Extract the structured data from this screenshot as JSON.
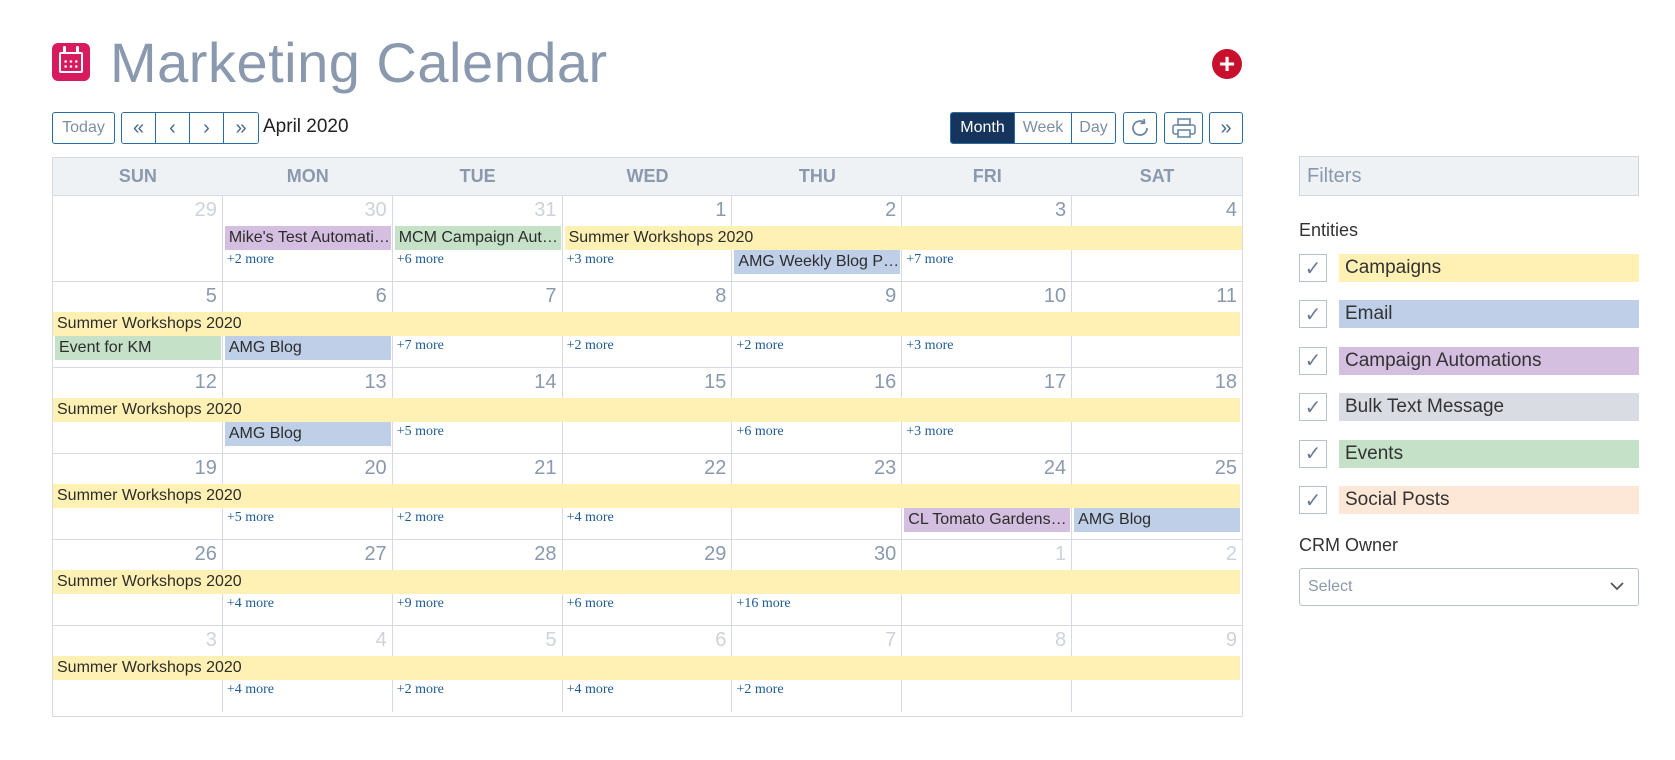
{
  "header": {
    "title": "Marketing Calendar",
    "add_label": "+"
  },
  "toolbar": {
    "today": "Today",
    "nav": [
      "«",
      "‹",
      "›",
      "»"
    ],
    "month_label": "April 2020",
    "views": [
      "Month",
      "Week",
      "Day"
    ],
    "active_view": "Month"
  },
  "calendar": {
    "days_of_week": [
      "SUN",
      "MON",
      "TUE",
      "WED",
      "THU",
      "FRI",
      "SAT"
    ],
    "weeks": [
      {
        "days": [
          [
            "29",
            true
          ],
          [
            "30",
            true
          ],
          [
            "31",
            true
          ],
          [
            "1",
            false
          ],
          [
            "2",
            false
          ],
          [
            "3",
            false
          ],
          [
            "4",
            false
          ]
        ],
        "events": [
          {
            "label": "Mike's Test Automation",
            "type": "auto",
            "start": 1,
            "span": 1,
            "row": 0
          },
          {
            "label": "MCM Campaign Automation",
            "type": "event",
            "start": 2,
            "span": 1,
            "row": 0
          },
          {
            "label": "Summer Workshops 2020",
            "type": "camp",
            "start": 3,
            "span": 4,
            "row": 0
          },
          {
            "label": "AMG Weekly Blog Post",
            "type": "email",
            "start": 4,
            "span": 1,
            "row": 1
          }
        ],
        "more": [
          {
            "label": "+2 more",
            "col": 1
          },
          {
            "label": "+6 more",
            "col": 2
          },
          {
            "label": "+3 more",
            "col": 3
          },
          {
            "label": "+7 more",
            "col": 5
          }
        ]
      },
      {
        "days": [
          [
            "5",
            false
          ],
          [
            "6",
            false
          ],
          [
            "7",
            false
          ],
          [
            "8",
            false
          ],
          [
            "9",
            false
          ],
          [
            "10",
            false
          ],
          [
            "11",
            false
          ]
        ],
        "events": [
          {
            "label": "Summer Workshops 2020",
            "type": "camp",
            "start": 0,
            "span": 7,
            "row": 0
          },
          {
            "label": "Event for KM",
            "type": "event",
            "start": 0,
            "span": 1,
            "row": 1
          },
          {
            "label": "AMG Blog",
            "type": "email",
            "start": 1,
            "span": 1,
            "row": 1
          }
        ],
        "more": [
          {
            "label": "+7 more",
            "col": 2
          },
          {
            "label": "+2 more",
            "col": 3
          },
          {
            "label": "+2 more",
            "col": 4
          },
          {
            "label": "+3 more",
            "col": 5
          }
        ]
      },
      {
        "days": [
          [
            "12",
            false
          ],
          [
            "13",
            false
          ],
          [
            "14",
            false
          ],
          [
            "15",
            false
          ],
          [
            "16",
            false
          ],
          [
            "17",
            false
          ],
          [
            "18",
            false
          ]
        ],
        "events": [
          {
            "label": "Summer Workshops 2020",
            "type": "camp",
            "start": 0,
            "span": 7,
            "row": 0
          },
          {
            "label": "AMG Blog",
            "type": "email",
            "start": 1,
            "span": 1,
            "row": 1
          }
        ],
        "more": [
          {
            "label": "+5 more",
            "col": 2
          },
          {
            "label": "+6 more",
            "col": 4
          },
          {
            "label": "+3 more",
            "col": 5
          }
        ]
      },
      {
        "days": [
          [
            "19",
            false
          ],
          [
            "20",
            false
          ],
          [
            "21",
            false
          ],
          [
            "22",
            false
          ],
          [
            "23",
            false
          ],
          [
            "24",
            false
          ],
          [
            "25",
            false
          ]
        ],
        "events": [
          {
            "label": "Summer Workshops 2020",
            "type": "camp",
            "start": 0,
            "span": 7,
            "row": 0
          },
          {
            "label": "CL Tomato Gardens Automation",
            "type": "auto",
            "start": 5,
            "span": 1,
            "row": 1
          },
          {
            "label": "AMG Blog",
            "type": "email",
            "start": 6,
            "span": 1,
            "row": 1
          }
        ],
        "more": [
          {
            "label": "+5 more",
            "col": 1
          },
          {
            "label": "+2 more",
            "col": 2
          },
          {
            "label": "+4 more",
            "col": 3
          }
        ]
      },
      {
        "days": [
          [
            "26",
            false
          ],
          [
            "27",
            false
          ],
          [
            "28",
            false
          ],
          [
            "29",
            false
          ],
          [
            "30",
            false
          ],
          [
            "1",
            true
          ],
          [
            "2",
            true
          ]
        ],
        "events": [
          {
            "label": "Summer Workshops 2020",
            "type": "camp",
            "start": 0,
            "span": 7,
            "row": 0
          }
        ],
        "more": [
          {
            "label": "+4 more",
            "col": 1
          },
          {
            "label": "+9 more",
            "col": 2
          },
          {
            "label": "+6 more",
            "col": 3
          },
          {
            "label": "+16 more",
            "col": 4
          }
        ]
      },
      {
        "days": [
          [
            "3",
            true
          ],
          [
            "4",
            true
          ],
          [
            "5",
            true
          ],
          [
            "6",
            true
          ],
          [
            "7",
            true
          ],
          [
            "8",
            true
          ],
          [
            "9",
            true
          ]
        ],
        "events": [
          {
            "label": "Summer Workshops 2020",
            "type": "camp",
            "start": 0,
            "span": 7,
            "row": 0
          }
        ],
        "more": [
          {
            "label": "+4 more",
            "col": 1
          },
          {
            "label": "+2 more",
            "col": 2
          },
          {
            "label": "+4 more",
            "col": 3
          },
          {
            "label": "+2 more",
            "col": 4
          }
        ]
      }
    ]
  },
  "sidebar": {
    "filters_title": "Filters",
    "entities_label": "Entities",
    "entities": [
      {
        "label": "Campaigns",
        "color": "#fff1b3",
        "checked": true
      },
      {
        "label": "Email",
        "color": "#bfcfe8",
        "checked": true
      },
      {
        "label": "Campaign Automations",
        "color": "#d5bfe0",
        "checked": true
      },
      {
        "label": "Bulk Text Message",
        "color": "#d9dde3",
        "checked": true
      },
      {
        "label": "Events",
        "color": "#c5e1c8",
        "checked": true
      },
      {
        "label": "Social Posts",
        "color": "#fde7d6",
        "checked": true
      }
    ],
    "crm_owner_label": "CRM Owner",
    "crm_owner_placeholder": "Select"
  }
}
